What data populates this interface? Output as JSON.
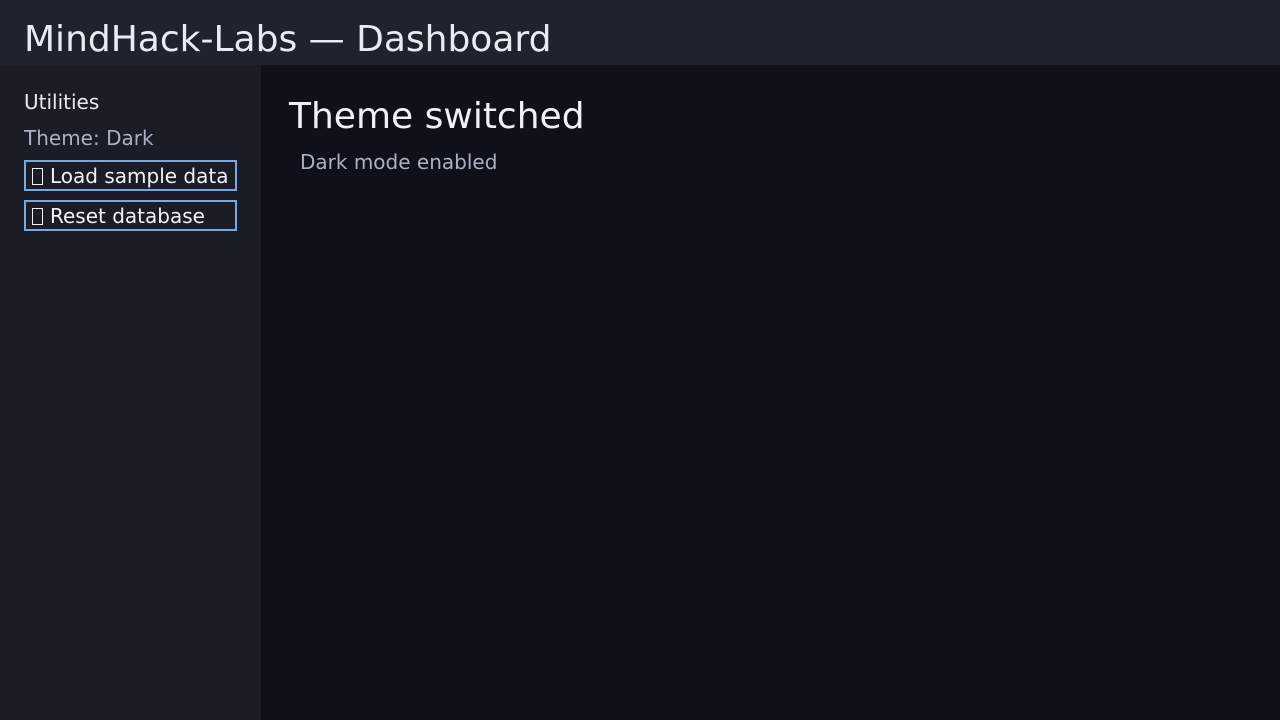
{
  "header": {
    "title": "MindHack-Labs — Dashboard"
  },
  "sidebar": {
    "heading": "Utilities",
    "theme_status": "Theme: Dark",
    "buttons": [
      {
        "label": "Load sample data",
        "icon": "missing-glyph-icon"
      },
      {
        "label": "Reset database",
        "icon": "missing-glyph-icon"
      }
    ]
  },
  "main": {
    "title": "Theme switched",
    "message": "Dark mode enabled"
  },
  "colors": {
    "header_bg": "#1f232e",
    "sidebar_bg": "#1a1d26",
    "main_bg": "#0e111a",
    "button_border": "#7aa7e0",
    "muted_text": "#a9b1c2",
    "primary_text": "#e8ebf2"
  }
}
